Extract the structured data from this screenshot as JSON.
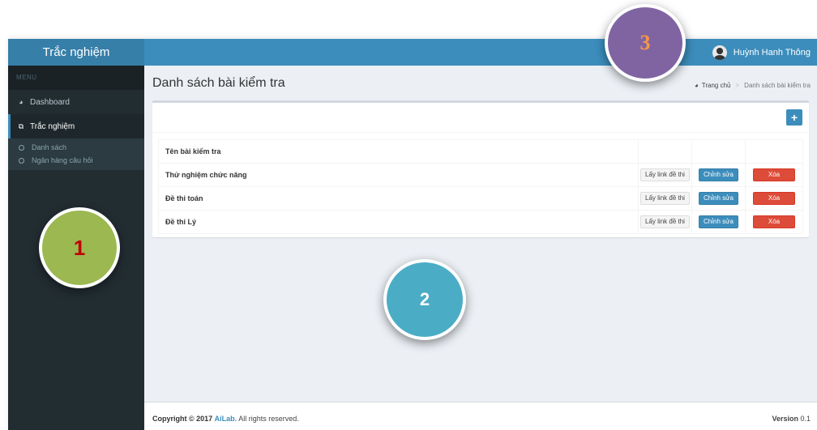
{
  "header": {
    "app_title": "Trắc nghiệm",
    "user_name": "Huỳnh Hanh Thông"
  },
  "sidebar": {
    "menu_label": "MENU",
    "items": [
      {
        "label": "Dashboard",
        "icon": "dashboard-icon",
        "active": false
      },
      {
        "label": "Trắc nghiệm",
        "icon": "copy-icon",
        "active": true
      }
    ],
    "subitems": [
      {
        "label": "Danh sách"
      },
      {
        "label": "Ngân hàng câu hỏi"
      }
    ]
  },
  "page": {
    "title": "Danh sách bài kiểm tra",
    "breadcrumb": {
      "home": "Trang chủ",
      "separator": ">",
      "current": "Danh sách bài kiểm tra"
    }
  },
  "box": {
    "add_button": "+",
    "table": {
      "header": "Tên bài kiểm tra",
      "rows": [
        {
          "name": "Thử nghiệm chức năng",
          "link": "Lấy link đề thi",
          "edit": "Chỉnh sửa",
          "delete": "Xóa"
        },
        {
          "name": "Đề thi toán",
          "link": "Lấy link đề thi",
          "edit": "Chỉnh sửa",
          "delete": "Xóa"
        },
        {
          "name": "Đề thi Lý",
          "link": "Lấy link đề thi",
          "edit": "Chỉnh sửa",
          "delete": "Xóa"
        }
      ]
    }
  },
  "footer": {
    "copyright_prefix": "Copyright © 2017",
    "brand": "AiLab.",
    "suffix": "All rights reserved.",
    "version_label": "Version",
    "version_number": "0.1"
  },
  "annotations": {
    "marker_1": "1",
    "marker_2": "2",
    "marker_3": "3"
  },
  "colors": {
    "header": "#3c8dbc",
    "logo": "#367fa9",
    "sidebar": "#222d32",
    "content_bg": "#ecf0f5",
    "danger": "#dd4b39",
    "marker_1": "#9cb851",
    "marker_2": "#4bacc6",
    "marker_3": "#8064a2"
  }
}
